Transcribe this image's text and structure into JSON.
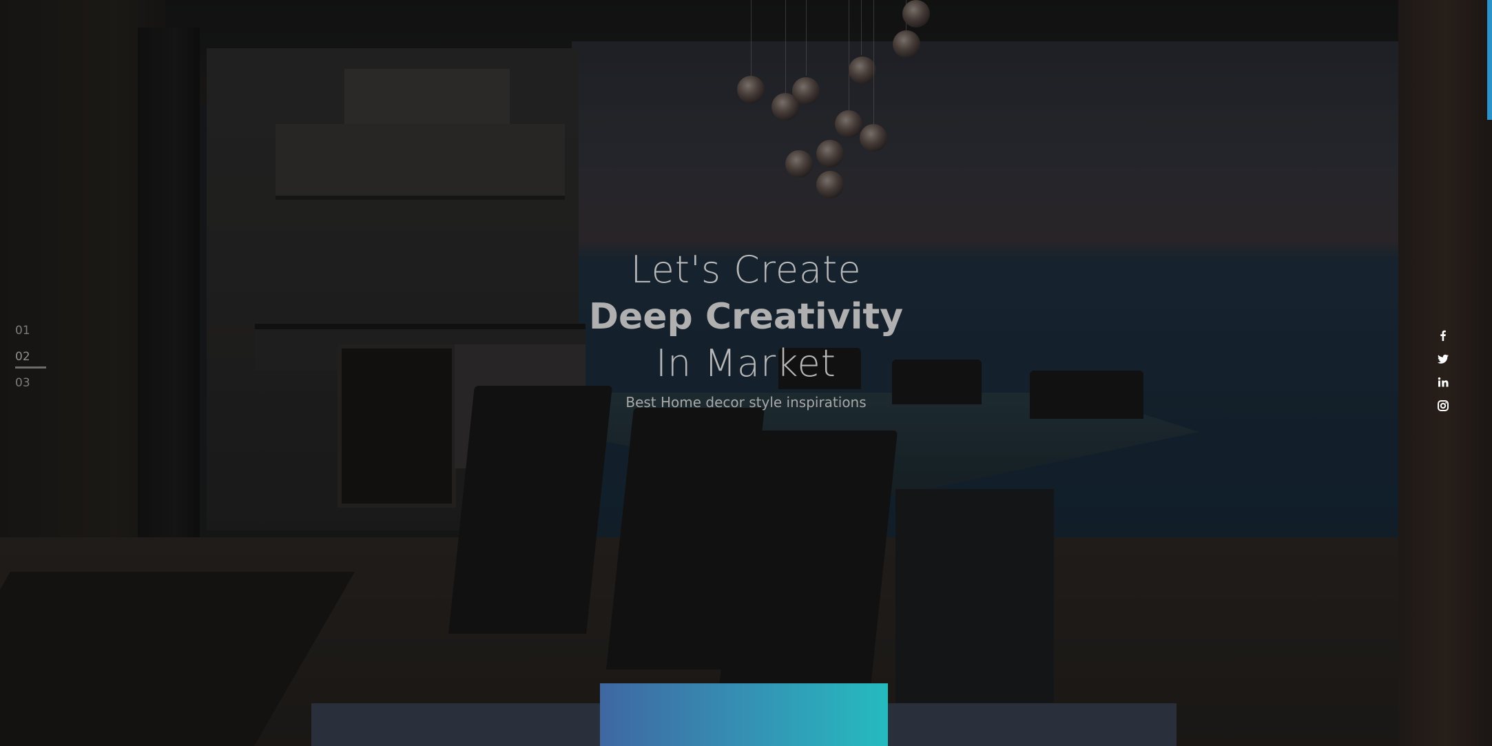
{
  "hero": {
    "line1": "Let's Create",
    "line2": "Deep Creativity",
    "line3": "In Market",
    "subtitle": "Best Home decor style inspirations"
  },
  "pager": {
    "items": [
      "01",
      "02",
      "03"
    ],
    "active_index": 1
  },
  "social": {
    "icons": [
      "facebook-icon",
      "twitter-icon",
      "linkedin-icon",
      "instagram-icon"
    ]
  },
  "colors": {
    "accent_scroll": "#2b93c9",
    "feature_gradient_start": "#3f67a2",
    "feature_gradient_end": "#25bbbf",
    "bottom_bar": "#2a3340"
  }
}
